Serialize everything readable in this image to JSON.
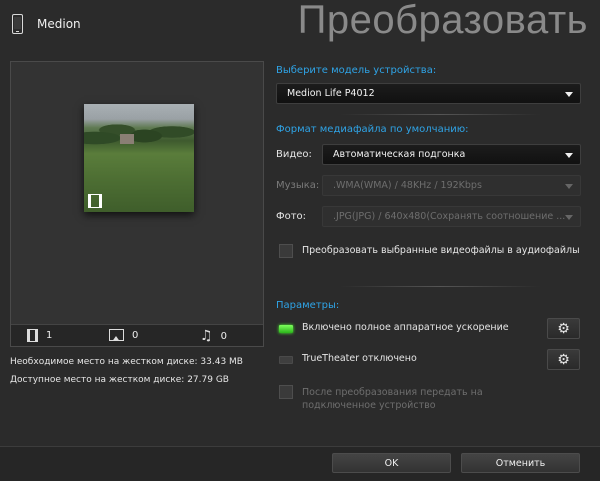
{
  "header": {
    "device_name": "Medion",
    "title": "Преобразовать"
  },
  "preview": {
    "counts": {
      "video": "1",
      "photo": "0",
      "music": "0"
    },
    "disk_required": "Необходимое место на жестком диске: 33.43 MB",
    "disk_available": "Доступное место на жестком диске: 27.79 GB"
  },
  "device": {
    "section_label": "Выберите модель устройства:",
    "model": "Medion Life P4012"
  },
  "format": {
    "section_label": "Формат медиафайла по умолчанию:",
    "video_label": "Видео:",
    "video_value": "Автоматическая подгонка",
    "music_label": "Музыка:",
    "music_value": ".WMA(WMA) / 48KHz / 192Kbps",
    "photo_label": "Фото:",
    "photo_value": ".JPG(JPG) / 640x480(Сохранять соотношение ...",
    "convert_audio_label": "Преобразовать выбранные видеофайлы в аудиофайлы"
  },
  "params": {
    "section_label": "Параметры:",
    "hw_accel_label": "Включено полное аппаратное ускорение",
    "truetheater_label": "TrueTheater отключено",
    "transfer_label": "После преобразования передать на подключенное устройство"
  },
  "footer": {
    "ok_label": "OK",
    "cancel_label": "Отменить"
  },
  "colors": {
    "accent": "#2fa4e7",
    "toggle_on": "#3ddc2a",
    "background": "#2b2b2b"
  }
}
